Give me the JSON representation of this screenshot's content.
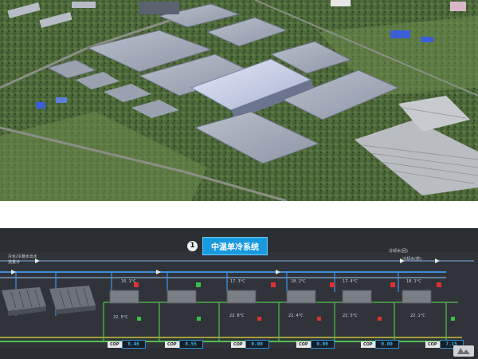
{
  "aerial": {
    "alt": "industrial-park-render"
  },
  "system": {
    "index": "1",
    "title": "中温单冷系统"
  },
  "labels": {
    "top_left_1": "冷水/冷凝水出水",
    "top_left_2": "流量计",
    "top_right_1": "冷却水(回)",
    "top_right_2": "冷却水(供)"
  },
  "chillers": [
    {
      "id": "c1",
      "temp_top": "",
      "temp_bottom": ""
    },
    {
      "id": "c2",
      "temp_top": "",
      "temp_bottom": ""
    },
    {
      "id": "c3",
      "temp_top": "16. 1°C",
      "temp_bottom": "22. 5°C"
    },
    {
      "id": "c4",
      "temp_top": "17. 3°C",
      "temp_bottom": "22. 8°C"
    },
    {
      "id": "c5",
      "temp_top": "18. 2°C",
      "temp_bottom": "22. 4°C"
    },
    {
      "id": "c6",
      "temp_top": "17. 4°C",
      "temp_bottom": "22. 5°C"
    },
    {
      "id": "c7",
      "temp_top": "18. 1°C",
      "temp_bottom": "22. 1°C"
    }
  ],
  "cop": [
    {
      "label": "COP",
      "value": "8.46"
    },
    {
      "label": "COP",
      "value": "8.55"
    },
    {
      "label": "COP",
      "value": "0.00"
    },
    {
      "label": "COP",
      "value": "0.00"
    },
    {
      "label": "COP",
      "value": "0.00"
    },
    {
      "label": "COP",
      "value": "7.15"
    }
  ],
  "colors": {
    "pipe_blue": "#3a8fe0",
    "pipe_green": "#4fc24f",
    "pipe_yellow": "#c9c23a",
    "status_red": "#e03030",
    "status_green": "#36c24a"
  }
}
